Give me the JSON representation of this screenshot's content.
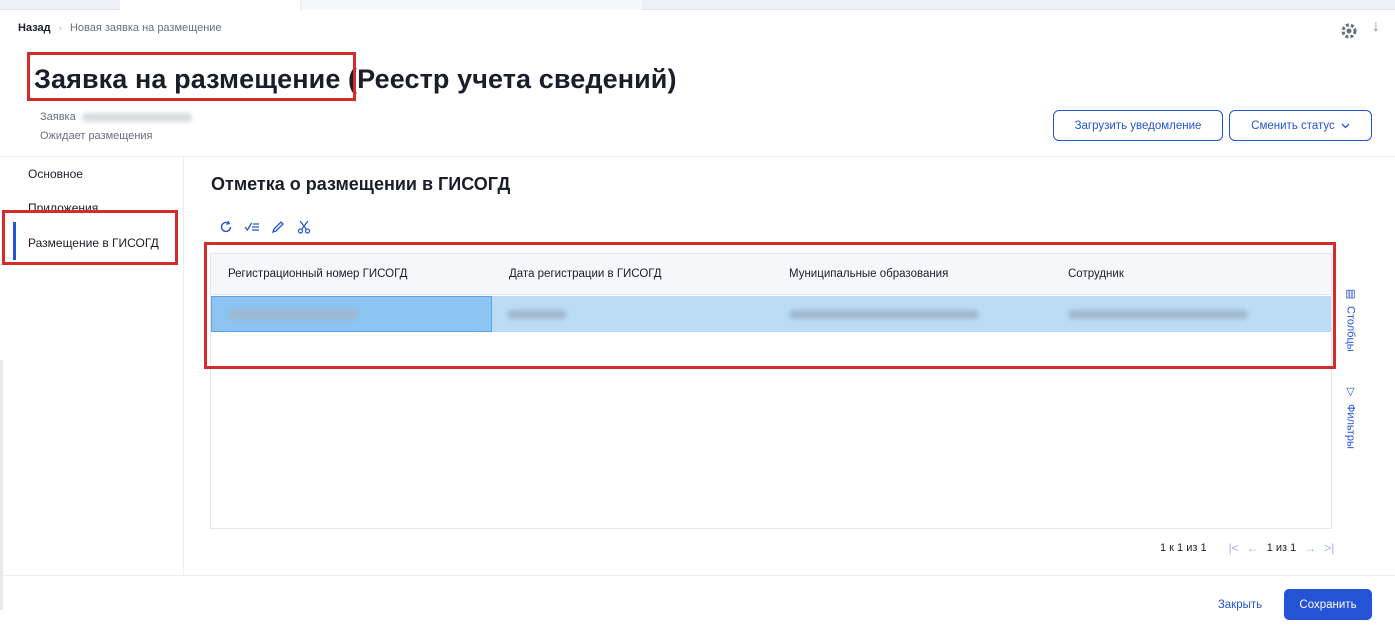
{
  "breadcrumb": {
    "back_label": "Назад",
    "current_label": "Новая заявка на размещение"
  },
  "page": {
    "title_main": "Заявка на размещение",
    "title_sub": "(Реестр учета сведений)",
    "request_label": "Заявка",
    "status_text": "Ожидает размещения"
  },
  "actions": {
    "upload_label": "Загрузить уведомление",
    "change_status_label": "Сменить статус"
  },
  "sidebar": {
    "items": [
      {
        "label": "Основное"
      },
      {
        "label": "Приложения"
      },
      {
        "label": "Размещение в ГИСОГД"
      }
    ],
    "active_index": 2
  },
  "section": {
    "title": "Отметка о размещении в ГИСОГД"
  },
  "toolbar": {
    "icons": [
      "refresh-icon",
      "check-list-icon",
      "edit-icon",
      "cut-icon"
    ]
  },
  "table": {
    "columns": [
      "Регистрационный номер ГИСОГД",
      "Дата регистрации в ГИСОГД",
      "Муниципальные образования",
      "Сотрудник"
    ]
  },
  "side_panel": {
    "columns_label": "Столбцы",
    "filters_label": "Фильтры"
  },
  "pagination": {
    "range_text": "1 к 1 из 1",
    "page_text": "1 из 1"
  },
  "footer": {
    "close_label": "Закрыть",
    "save_label": "Сохранить"
  },
  "colors": {
    "accent": "#2453d6",
    "highlight_box": "#d42b2b",
    "row_selected": "#bcdcf6"
  }
}
